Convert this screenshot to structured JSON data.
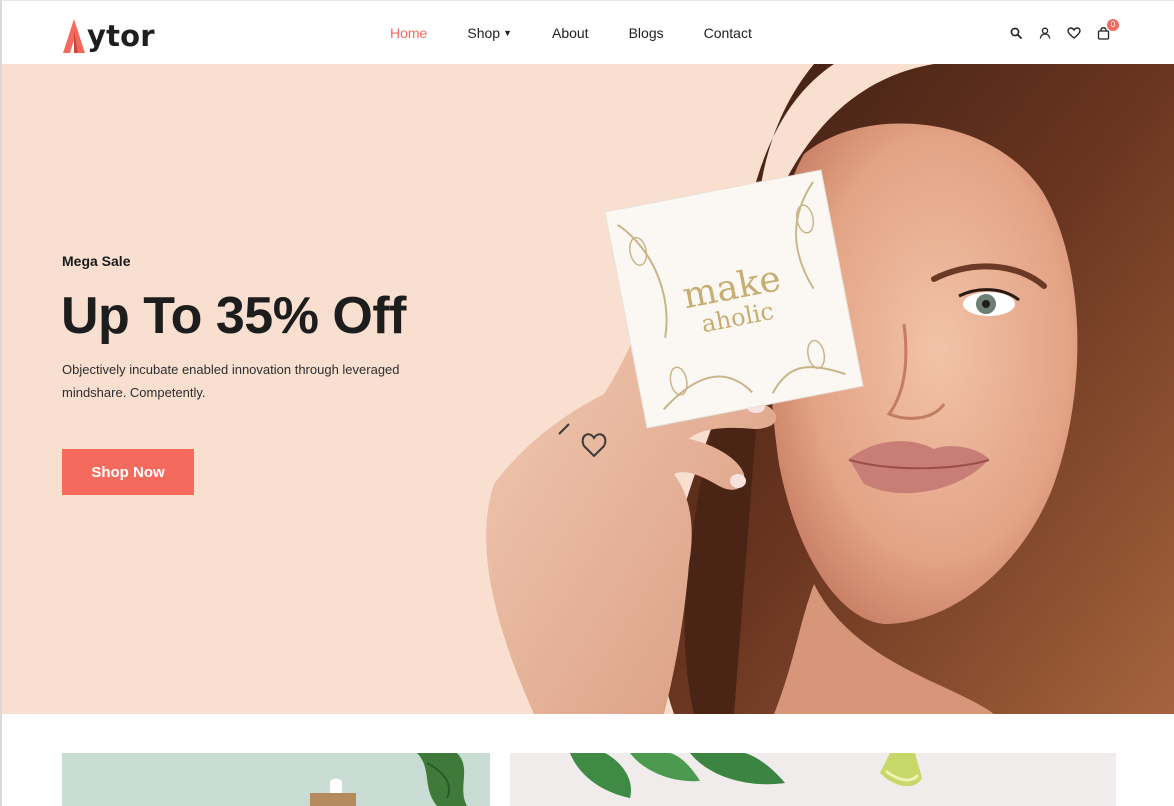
{
  "brand": {
    "name": "ytor",
    "accent": "#f46b5d"
  },
  "nav": {
    "items": [
      {
        "label": "Home",
        "active": true
      },
      {
        "label": "Shop",
        "dropdown": true
      },
      {
        "label": "About"
      },
      {
        "label": "Blogs"
      },
      {
        "label": "Contact"
      }
    ]
  },
  "header_icons": [
    "search-icon",
    "user-icon",
    "heart-icon",
    "cart-icon"
  ],
  "cart": {
    "count": "0"
  },
  "hero": {
    "eyebrow": "Mega Sale",
    "title": "Up To 35% Off",
    "text": "Objectively incubate enabled innovation through leveraged mindshare. Competently.",
    "button_label": "Shop Now",
    "card_text_line1": "make",
    "card_text_line2": "aholic",
    "background": "#f8dfd0"
  },
  "banners": {
    "left_background": "#c9dcd3",
    "right_background": "#efeceb"
  }
}
